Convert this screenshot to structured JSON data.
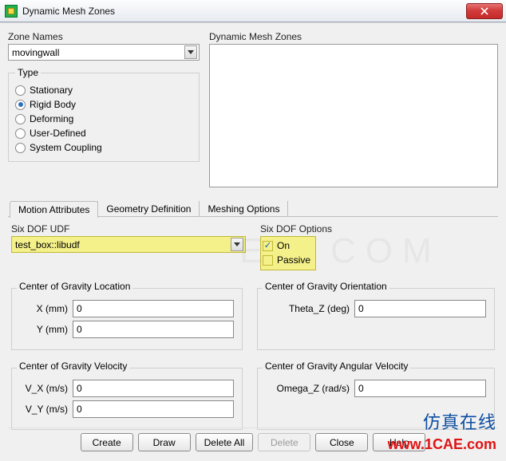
{
  "window": {
    "title": "Dynamic Mesh Zones"
  },
  "zone_names": {
    "label": "Zone Names",
    "selected": "movingwall"
  },
  "type": {
    "legend": "Type",
    "options": {
      "stationary": "Stationary",
      "rigid_body": "Rigid Body",
      "deforming": "Deforming",
      "user_defined": "User-Defined",
      "system_coupling": "System Coupling"
    },
    "selected": "rigid_body"
  },
  "dmz_list": {
    "label": "Dynamic Mesh Zones"
  },
  "tabs": {
    "motion": "Motion Attributes",
    "geometry": "Geometry Definition",
    "meshing": "Meshing Options",
    "active": "motion"
  },
  "six_dof_udf": {
    "label": "Six DOF UDF",
    "selected": "test_box::libudf"
  },
  "six_dof_options": {
    "label": "Six DOF Options",
    "on_label": "On",
    "passive_label": "Passive",
    "on_checked": true,
    "passive_checked": false
  },
  "cg_location": {
    "legend": "Center of Gravity Location",
    "x_label": "X (mm)",
    "y_label": "Y (mm)",
    "x": "0",
    "y": "0"
  },
  "cg_orientation": {
    "legend": "Center of Gravity Orientation",
    "theta_z_label": "Theta_Z (deg)",
    "theta_z": "0"
  },
  "cg_velocity": {
    "legend": "Center of Gravity Velocity",
    "vx_label": "V_X (m/s)",
    "vy_label": "V_Y (m/s)",
    "vx": "0",
    "vy": "0"
  },
  "cg_angular_velocity": {
    "legend": "Center of Gravity Angular Velocity",
    "omega_z_label": "Omega_Z (rad/s)",
    "omega_z": "0"
  },
  "buttons": {
    "create": "Create",
    "draw": "Draw",
    "delete_all": "Delete All",
    "delete": "Delete",
    "close": "Close",
    "help": "Help"
  },
  "watermark": {
    "cn": "仿真在线",
    "url": "www.1CAE.com",
    "ghost": "E . COM"
  }
}
